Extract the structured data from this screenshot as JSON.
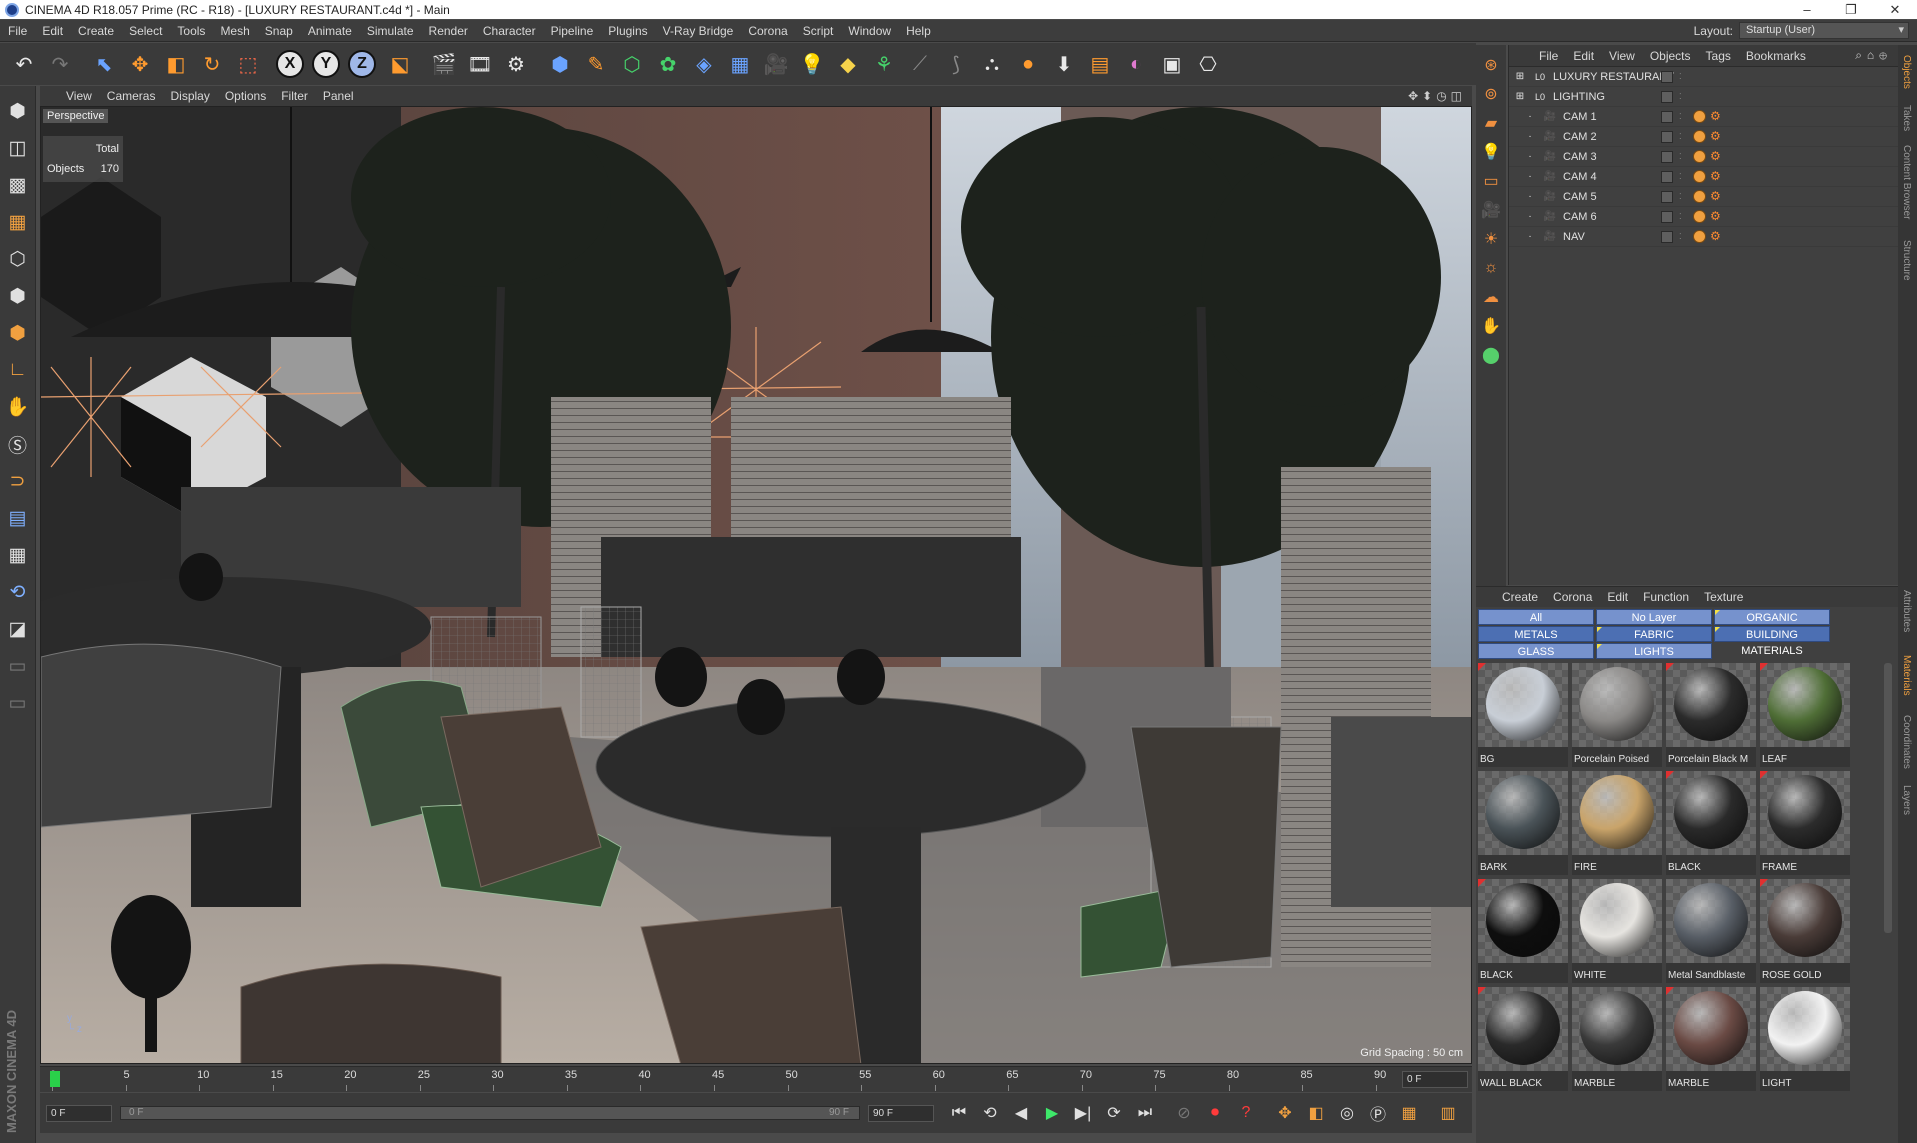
{
  "window": {
    "title": "CINEMA 4D R18.057 Prime (RC - R18) - [LUXURY RESTAURANT.c4d *] - Main"
  },
  "menubar": {
    "items": [
      "File",
      "Edit",
      "Create",
      "Select",
      "Tools",
      "Mesh",
      "Snap",
      "Animate",
      "Simulate",
      "Render",
      "Character",
      "Pipeline",
      "Plugins",
      "V-Ray Bridge",
      "Corona",
      "Script",
      "Window",
      "Help"
    ],
    "layout_label": "Layout:",
    "layout_value": "Startup (User)"
  },
  "viewport": {
    "menu": [
      "View",
      "Cameras",
      "Display",
      "Options",
      "Filter",
      "Panel"
    ],
    "label": "Perspective",
    "stats": {
      "total_label": "Total",
      "objects_label": "Objects",
      "objects_count": "170"
    },
    "grid_spacing": "Grid Spacing : 50 cm"
  },
  "timeline": {
    "ticks": [
      "0",
      "5",
      "10",
      "15",
      "20",
      "25",
      "30",
      "35",
      "40",
      "45",
      "50",
      "55",
      "60",
      "65",
      "70",
      "75",
      "80",
      "85",
      "90"
    ],
    "current_frame": "0 F"
  },
  "transport": {
    "start_field": "0 F",
    "slider_start": "0 F",
    "slider_end": "90 F",
    "end_field": "90 F"
  },
  "object_manager": {
    "menu": [
      "File",
      "Edit",
      "View",
      "Objects",
      "Tags",
      "Bookmarks"
    ],
    "objects": [
      {
        "name": "LUXURY RESTAURANT",
        "kind": "layer",
        "tags": false
      },
      {
        "name": "LIGHTING",
        "kind": "layer",
        "tags": false
      },
      {
        "name": "CAM 1",
        "kind": "cam",
        "tags": true
      },
      {
        "name": "CAM 2",
        "kind": "cam",
        "tags": true
      },
      {
        "name": "CAM 3",
        "kind": "cam",
        "tags": true
      },
      {
        "name": "CAM 4",
        "kind": "cam",
        "tags": true
      },
      {
        "name": "CAM 5",
        "kind": "cam",
        "tags": true
      },
      {
        "name": "CAM 6",
        "kind": "cam",
        "tags": true
      },
      {
        "name": "NAV",
        "kind": "cam",
        "tags": true
      }
    ]
  },
  "material_manager": {
    "menu": [
      "Create",
      "Corona",
      "Edit",
      "Function",
      "Texture"
    ],
    "layers": [
      "All",
      "No Layer",
      "ORGANIC",
      "METALS",
      "FABRIC",
      "BUILDING MATERIALS",
      "GLASS",
      "LIGHTS"
    ],
    "materials": [
      {
        "name": "BG",
        "color": "#c8ced6"
      },
      {
        "name": "Porcelain Poised",
        "color": "#8a8886"
      },
      {
        "name": "Porcelain Black M",
        "color": "#2b2b2b"
      },
      {
        "name": "LEAF",
        "color": "#4f6e36"
      },
      {
        "name": "BARK",
        "color": "#4a5358"
      },
      {
        "name": "FIRE",
        "color": "#c9a46a"
      },
      {
        "name": "BLACK",
        "color": "#2a2a2a"
      },
      {
        "name": "FRAME",
        "color": "#2c2c2c"
      },
      {
        "name": "BLACK",
        "color": "#0e0e0e"
      },
      {
        "name": "WHITE",
        "color": "#e6e4e0"
      },
      {
        "name": "Metal Sandblaste",
        "color": "#585e66"
      },
      {
        "name": "ROSE GOLD",
        "color": "#4a3c38"
      },
      {
        "name": "WALL BLACK",
        "color": "#2a2a2a"
      },
      {
        "name": "MARBLE",
        "color": "#3a3a3a"
      },
      {
        "name": "MARBLE",
        "color": "#6a4a44"
      },
      {
        "name": "LIGHT",
        "color": "#f2f2f2"
      }
    ]
  },
  "side_tabs": [
    "Objects",
    "Takes",
    "Content Browser",
    "Structure",
    "Attributes",
    "Materials",
    "Coordinates",
    "Layers"
  ]
}
